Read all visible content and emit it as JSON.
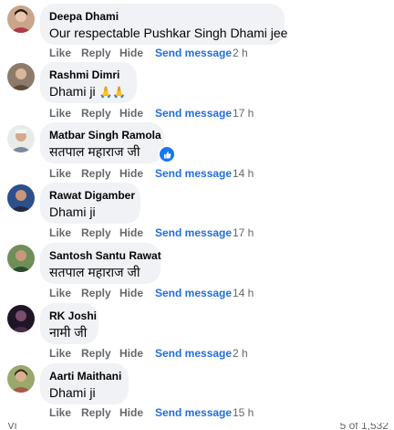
{
  "colors": {
    "bubble": "#f0f2f5",
    "action_text": "#65676b",
    "send_message": "#216fdb",
    "reaction_badge": "#1877f2"
  },
  "comments": [
    {
      "author": "Deepa Dhami",
      "text": "Our respectable Pushkar Singh Dhami jee",
      "like": "Like",
      "reply": "Reply",
      "hide": "Hide",
      "send_message": "Send message",
      "time": "2 h"
    },
    {
      "author": "Rashmi Dimri",
      "text": "Dhami ji",
      "emoji": "🙏🙏",
      "like": "Like",
      "reply": "Reply",
      "hide": "Hide",
      "send_message": "Send message",
      "time": "17 h"
    },
    {
      "author": "Matbar Singh Ramola",
      "text": "सतपाल महाराज जी",
      "reaction_icon": "like-reaction-icon",
      "like": "Like",
      "reply": "Reply",
      "hide": "Hide",
      "send_message": "Send message",
      "time": "14 h"
    },
    {
      "author": "Rawat Digamber",
      "text": "Dhami ji",
      "like": "Like",
      "reply": "Reply",
      "hide": "Hide",
      "send_message": "Send message",
      "time": "17 h"
    },
    {
      "author": "Santosh Santu Rawat",
      "text": "सतपाल महाराज जी",
      "like": "Like",
      "reply": "Reply",
      "hide": "Hide",
      "send_message": "Send message",
      "time": "14 h"
    },
    {
      "author": "RK Joshi",
      "text": "नामी जी",
      "like": "Like",
      "reply": "Reply",
      "hide": "Hide",
      "send_message": "Send message",
      "time": "2 h"
    },
    {
      "author": "Aarti Maithani",
      "text": "Dhami ji",
      "like": "Like",
      "reply": "Reply",
      "hide": "Hide",
      "send_message": "Send message",
      "time": "15 h"
    }
  ],
  "footer": {
    "left": "Vi",
    "right": "5 of 1,532"
  }
}
